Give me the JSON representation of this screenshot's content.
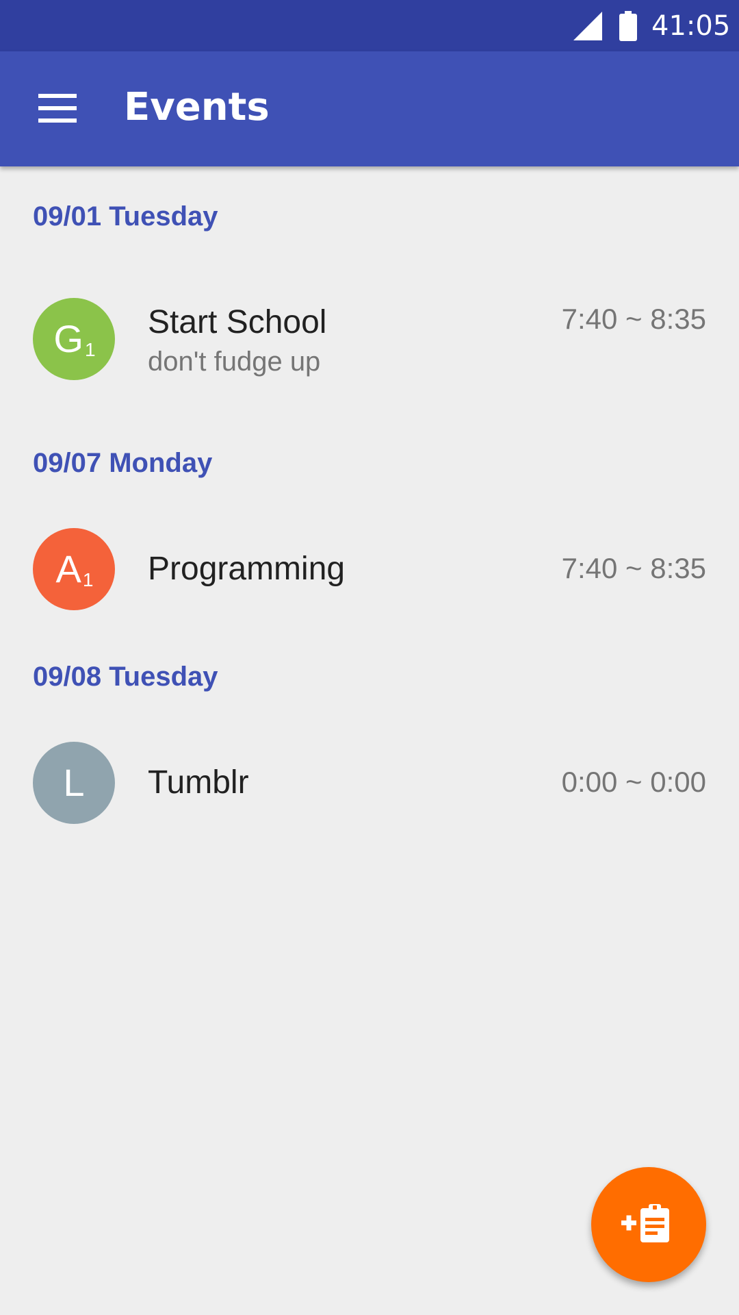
{
  "status_bar": {
    "time": "41:05",
    "signal_icon": "cell-signal-icon",
    "battery_icon": "battery-icon",
    "color": "#303f9f"
  },
  "app_bar": {
    "title": "Events",
    "menu_icon": "hamburger-menu-icon",
    "color": "#3f51b5"
  },
  "sections": [
    {
      "date": "09/01 Tuesday",
      "events": [
        {
          "avatar_letter": "G",
          "avatar_subscript": "1",
          "avatar_color": "#8bc34a",
          "title": "Start School",
          "subtitle": "don't fudge up",
          "time": "7:40 ~ 8:35"
        }
      ]
    },
    {
      "date": "09/07 Monday",
      "events": [
        {
          "avatar_letter": "A",
          "avatar_subscript": "1",
          "avatar_color": "#f4623a",
          "title": "Programming",
          "subtitle": "",
          "time": "7:40 ~ 8:35"
        }
      ]
    },
    {
      "date": "09/08 Tuesday",
      "events": [
        {
          "avatar_letter": "L",
          "avatar_subscript": "",
          "avatar_color": "#90a4ae",
          "title": "Tumblr",
          "subtitle": "",
          "time": "0:00 ~ 0:00"
        }
      ]
    }
  ],
  "fab": {
    "icon": "add-assignment-icon",
    "color": "#ff6d00"
  },
  "theme": {
    "accent": "#3f51b5",
    "background": "#eeeeee"
  }
}
